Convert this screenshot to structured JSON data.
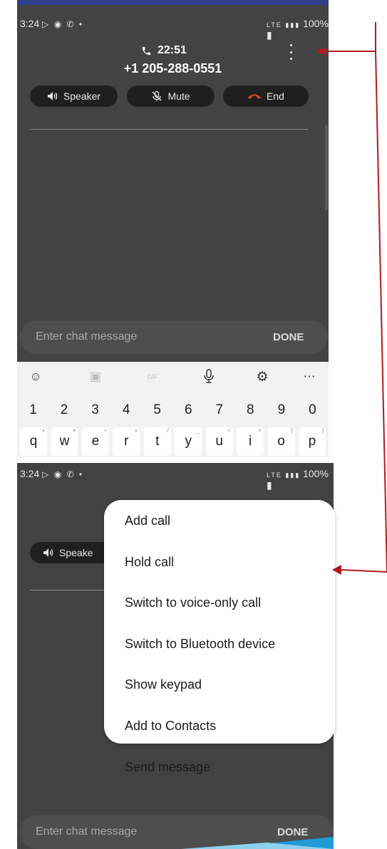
{
  "top_screen": {
    "status_bar": {
      "time": "3:24",
      "battery": "100%"
    },
    "call": {
      "timer": "22:51",
      "number": "+1 205-288-0551"
    },
    "actions": [
      {
        "label": "Speaker"
      },
      {
        "label": "Mute"
      },
      {
        "label": "End"
      }
    ],
    "chat": {
      "placeholder": "Enter chat message",
      "done_label": "DONE"
    },
    "keyboard": {
      "number_row": [
        "1",
        "2",
        "3",
        "4",
        "5",
        "6",
        "7",
        "8",
        "9",
        "0"
      ],
      "letter_row": [
        "q",
        "w",
        "e",
        "r",
        "t",
        "y",
        "u",
        "i",
        "o",
        "p"
      ],
      "letter_hints": [
        "+",
        "×",
        "÷",
        "=",
        "/",
        "_",
        "<",
        ">",
        "[",
        "]"
      ]
    }
  },
  "bottom_screen": {
    "status_bar": {
      "time": "3:24",
      "battery": "100%"
    },
    "speaker_label": "Speake",
    "menu": [
      "Add call",
      "Hold call",
      "Switch to voice-only call",
      "Switch to Bluetooth device",
      "Show keypad",
      "Add to Contacts",
      "Send message"
    ],
    "chat": {
      "placeholder": "Enter chat message",
      "done_label": "DONE"
    }
  },
  "colors": {
    "annotation_arrow": "#b01c1c",
    "end_call_red": "#e0453a",
    "screen_bg": "#434343"
  }
}
